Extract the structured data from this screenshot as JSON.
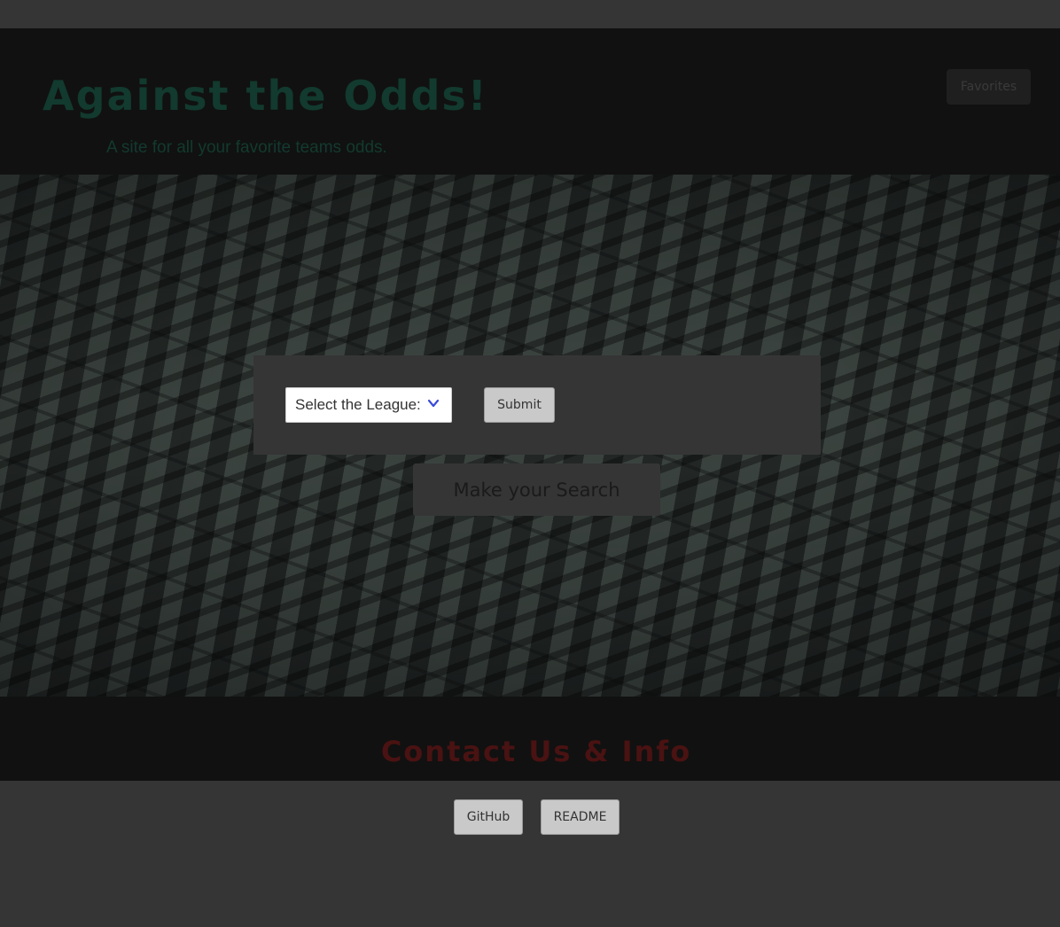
{
  "header": {
    "title": "Against the Odds!",
    "subtitle": "A site for all your favorite teams odds.",
    "favorites_label": "Favorites"
  },
  "search": {
    "select_label": "Select the League:",
    "submit_label": "Submit",
    "prompt": "Make your Search"
  },
  "footer": {
    "contact_title": "Contact Us & Info",
    "github_label": "GitHub",
    "readme_label": "README"
  },
  "colors": {
    "title": "#123a2e",
    "contact_title": "#4a1212",
    "chevron": "#3b4bd8"
  },
  "icons": {
    "select_arrow": "chevron-down-icon"
  }
}
